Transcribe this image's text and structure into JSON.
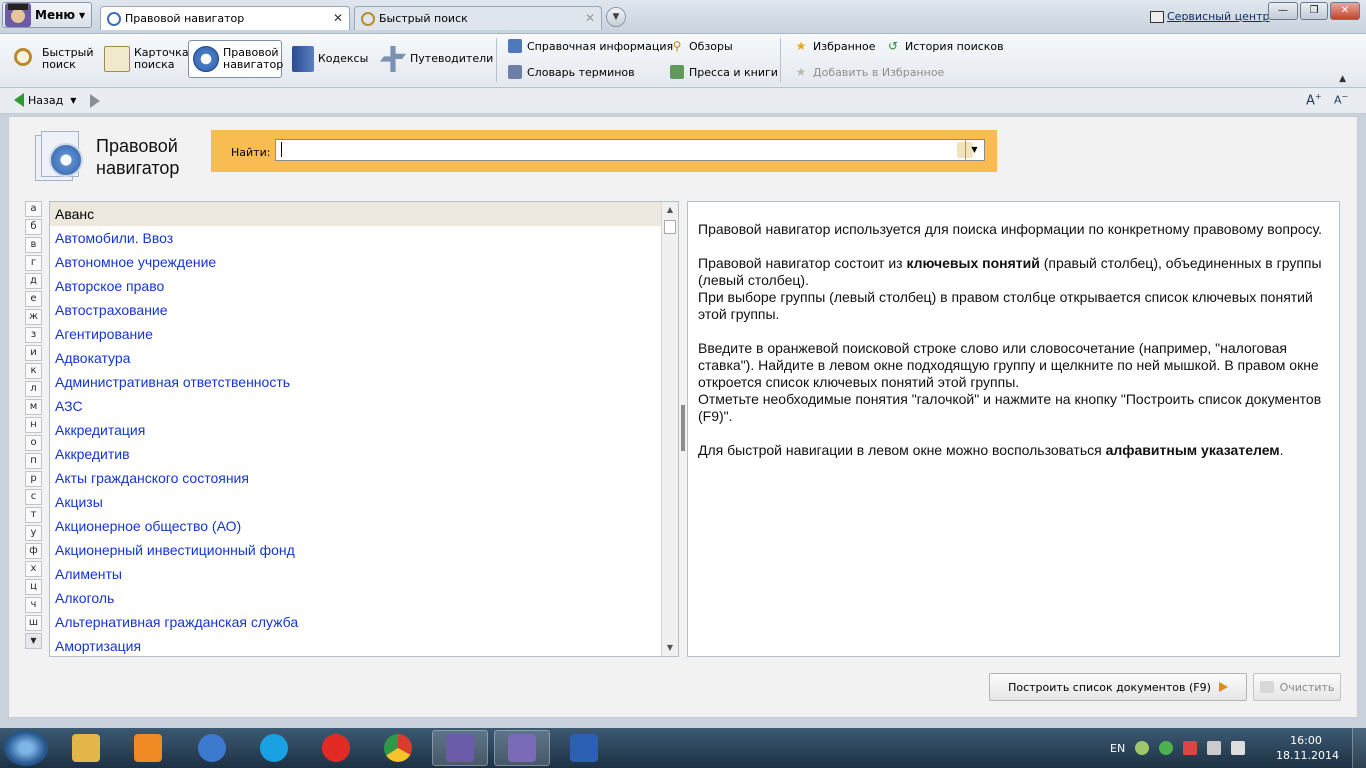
{
  "window": {
    "menu_label": "Меню",
    "tabs": [
      {
        "label": "Правовой навигатор",
        "close": "✕"
      },
      {
        "label": "Быстрый поиск",
        "close": "✕"
      }
    ],
    "service_link": "Сервисный центр"
  },
  "ribbon": {
    "big": [
      {
        "label1": "Быстрый",
        "label2": "поиск"
      },
      {
        "label1": "Карточка",
        "label2": "поиска"
      },
      {
        "label1": "Правовой",
        "label2": "навигатор"
      },
      {
        "label1": "Кодексы",
        "label2": ""
      },
      {
        "label1": "Путеводители",
        "label2": ""
      }
    ],
    "small": {
      "reference": "Справочная информация",
      "reviews": "Обзоры",
      "dictionary": "Словарь терминов",
      "press": "Пресса и книги",
      "favorites": "Избранное",
      "history": "История поисков",
      "add_favorites": "Добавить в Избранное"
    }
  },
  "navbar": {
    "back_label": "Назад"
  },
  "navigator": {
    "title_line1": "Правовой",
    "title_line2": "навигатор",
    "search_label": "Найти:",
    "search_value": ""
  },
  "alphabet": [
    "а",
    "б",
    "в",
    "г",
    "д",
    "е",
    "ж",
    "з",
    "и",
    "к",
    "л",
    "м",
    "н",
    "о",
    "п",
    "р",
    "с",
    "т",
    "у",
    "ф",
    "х",
    "ц",
    "ч",
    "ш"
  ],
  "groups": [
    "Аванс",
    "Автомобили. Ввоз",
    "Автономное учреждение",
    "Авторское право",
    "Автострахование",
    "Агентирование",
    "Адвокатура",
    "Административная ответственность",
    "АЗС",
    "Аккредитация",
    "Аккредитив",
    "Акты гражданского состояния",
    "Акцизы",
    "Акционерное общество (АО)",
    "Акционерный инвестиционный фонд",
    "Алименты",
    "Алкоголь",
    "Альтернативная гражданская служба",
    "Амортизация"
  ],
  "help": {
    "p1": "Правовой навигатор используется для поиска информации по конкретному правовому вопросу.",
    "p2_a": "Правовой навигатор состоит из ",
    "p2_b": "ключевых понятий",
    "p2_c": " (правый столбец), объединенных в группы (левый столбец).",
    "p2_d": "При выборе группы (левый столбец) в правом столбце открывается список ключевых понятий этой группы.",
    "p3_a": "Введите в оранжевой поисковой строке слово или словосочетание (например, \"налоговая ставка\"). Найдите в левом окне подходящую группу и щелкните по ней мышкой. В правом окне откроется список ключевых понятий этой группы.",
    "p3_b": "Отметьте необходимые понятия \"галочкой\" и нажмите на кнопку \"Построить список документов (F9)\".",
    "p4_a": "Для быстрой навигации в левом окне можно воспользоваться ",
    "p4_b": "алфавитным указателем",
    "p4_c": "."
  },
  "buttons": {
    "build": "Построить список документов (F9)",
    "clear": "Очистить"
  },
  "taskbar": {
    "lang": "EN",
    "time": "16:00",
    "date": "18.11.2014"
  },
  "colors": {
    "link": "#1535d4",
    "search_bar": "#f9bc52",
    "selected_row": "#ece8de"
  }
}
